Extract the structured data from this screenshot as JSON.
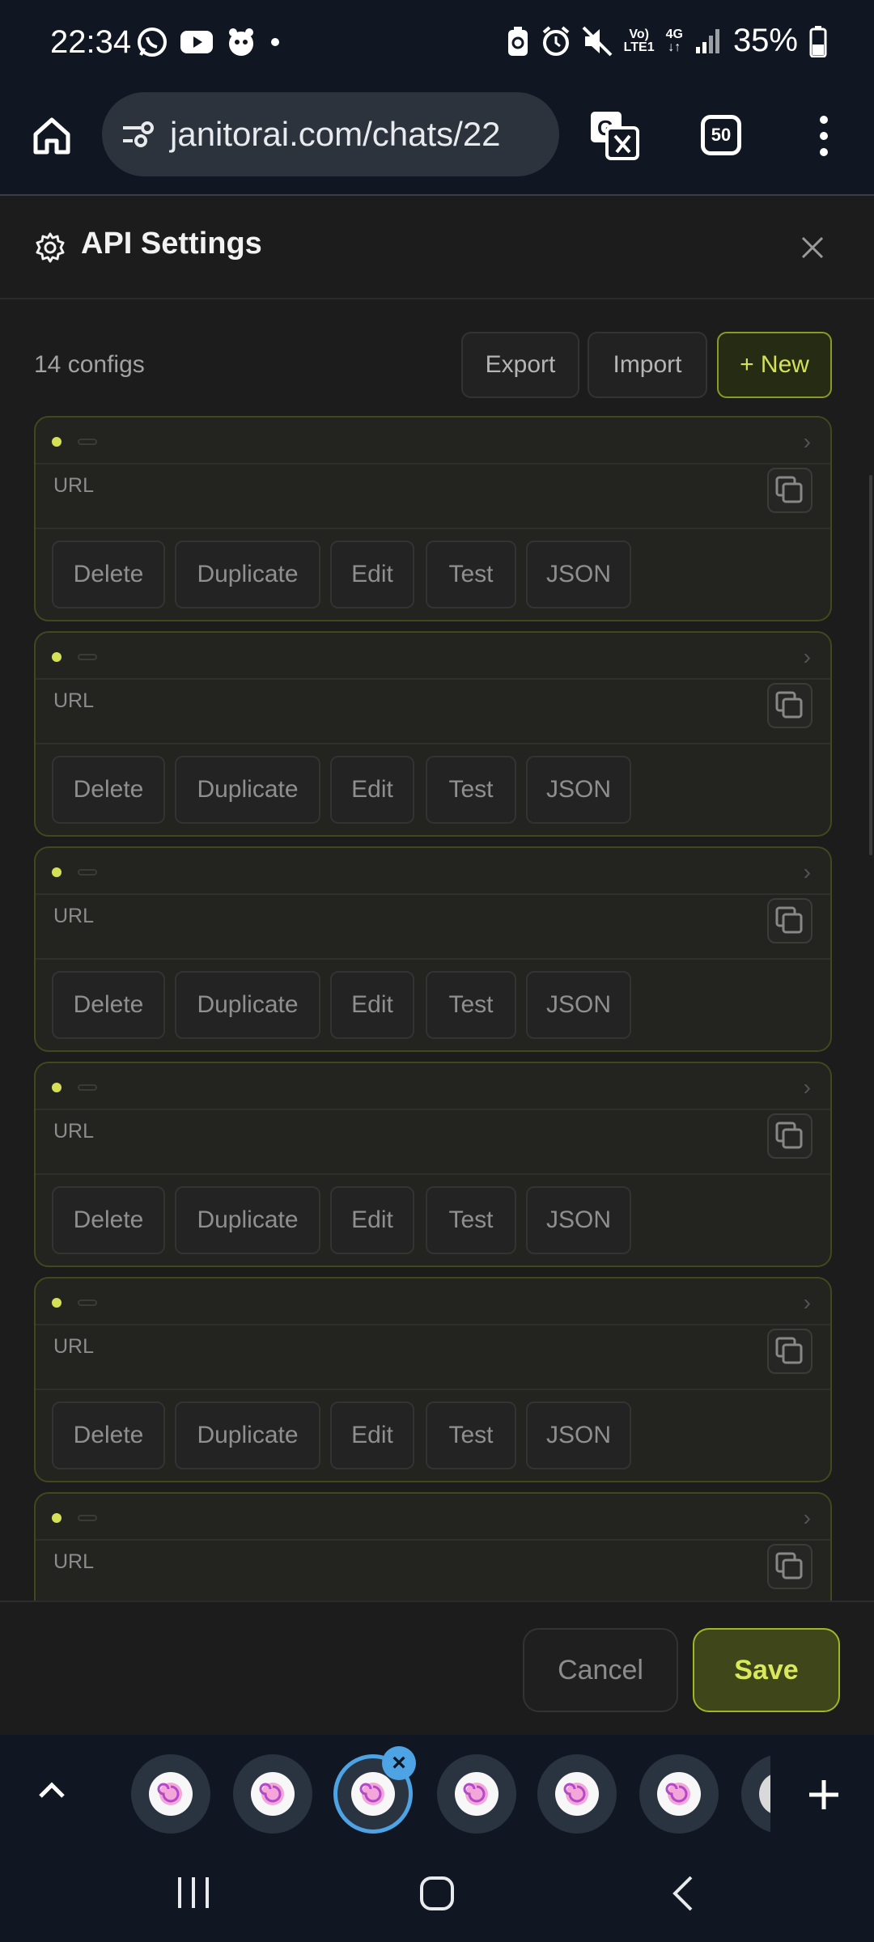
{
  "status_bar": {
    "time": "22:34",
    "network_top": "Vo)",
    "network_bottom": "LTE1",
    "signal_type": "4G",
    "battery_percent": "35%"
  },
  "browser": {
    "url": "janitorai.com/chats/22",
    "tab_count": "50"
  },
  "modal": {
    "title": "API Settings",
    "config_count": "14 configs",
    "export_label": "Export",
    "import_label": "Import",
    "new_label": "+ New",
    "cards": [
      {
        "url_label": "URL"
      },
      {
        "url_label": "URL"
      },
      {
        "url_label": "URL"
      },
      {
        "url_label": "URL"
      },
      {
        "url_label": "URL"
      },
      {
        "url_label": "URL"
      }
    ],
    "actions": {
      "delete": "Delete",
      "duplicate": "Duplicate",
      "edit": "Edit",
      "test": "Test",
      "json": "JSON"
    },
    "cancel_label": "Cancel",
    "save_label": "Save"
  },
  "colors": {
    "accent": "#d4e157",
    "tab_active": "#4da3e3"
  }
}
